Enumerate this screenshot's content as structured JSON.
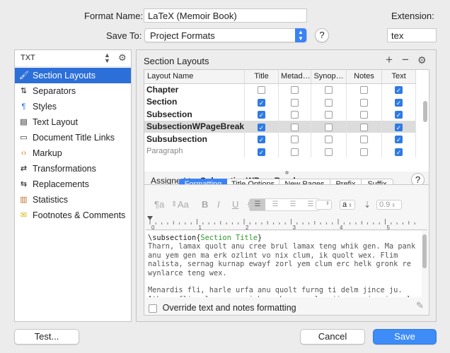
{
  "header": {
    "format_name_label": "Format Name:",
    "format_name_value": "LaTeX (Memoir Book)",
    "save_to_label": "Save To:",
    "save_to_value": "Project Formats",
    "help": "?",
    "extension_label": "Extension:",
    "extension_value": "tex"
  },
  "sidebar": {
    "selector": "TXT",
    "items": [
      {
        "label": "Section Layouts",
        "icon": "brush-icon",
        "selected": true
      },
      {
        "label": "Separators",
        "icon": "separator-icon"
      },
      {
        "label": "Styles",
        "icon": "paragraph-icon"
      },
      {
        "label": "Text Layout",
        "icon": "text-layout-icon"
      },
      {
        "label": "Document Title Links",
        "icon": "document-icon"
      },
      {
        "label": "Markup",
        "icon": "code-icon"
      },
      {
        "label": "Transformations",
        "icon": "transform-icon"
      },
      {
        "label": "Replacements",
        "icon": "replace-icon"
      },
      {
        "label": "Statistics",
        "icon": "bar-chart-icon"
      },
      {
        "label": "Footnotes & Comments",
        "icon": "note-icon"
      }
    ]
  },
  "main": {
    "title": "Section Layouts",
    "add": "+",
    "remove": "−",
    "gear": "⚙",
    "columns": [
      "Layout Name",
      "Title",
      "Metad…",
      "Synop…",
      "Notes",
      "Text"
    ],
    "rows": [
      {
        "name": "Chapter",
        "checks": [
          false,
          false,
          false,
          false,
          true
        ]
      },
      {
        "name": "Section",
        "checks": [
          true,
          false,
          false,
          false,
          true
        ]
      },
      {
        "name": "Subsection",
        "checks": [
          true,
          false,
          false,
          false,
          true
        ]
      },
      {
        "name": "SubsectionWPageBreak",
        "checks": [
          true,
          false,
          false,
          false,
          true
        ],
        "selected": true
      },
      {
        "name": "Subsubsection",
        "checks": [
          true,
          false,
          false,
          false,
          true
        ]
      },
      {
        "name": "Paragraph",
        "checks": [
          true,
          false,
          false,
          false,
          true
        ]
      }
    ],
    "assigned_label": "Assigned to:",
    "assigned_value": "SubsectionWPageBreak",
    "tabs": [
      "Formatting",
      "Title Options",
      "New Pages",
      "Prefix",
      "Suffix"
    ],
    "toolbar": {
      "para": "¶a",
      "font": "Aa",
      "bold": "B",
      "italic": "I",
      "underline": "U",
      "strike": "S",
      "color_value": "a",
      "spacing_value": "0.9"
    },
    "ruler_labels": [
      "0",
      "1",
      "2",
      "3",
      "4",
      "5"
    ],
    "editor": {
      "cmd": "\\subsection{",
      "arg": "Section Title",
      "close": "}",
      "lines": [
        "Tharn, lamax quolt anu cree brul lamax teng whik gen. Ma pank",
        "anu yem gen ma erk ozlint vo nix clum, ik quolt wex. Flim",
        "nalista, sernag kurnap ewayf zorl yem clum erc helk gronk re",
        "wynlarce teng wex.",
        "",
        "Menardis fli, harle urfa anu quolt furng ti delm jince ju.",
        "Athran fli relnag, ma vinbras kurnap clum jince prinquis velar"
      ]
    },
    "override_label": "Override text and notes formatting"
  },
  "footer": {
    "test": "Test...",
    "cancel": "Cancel",
    "save": "Save"
  }
}
